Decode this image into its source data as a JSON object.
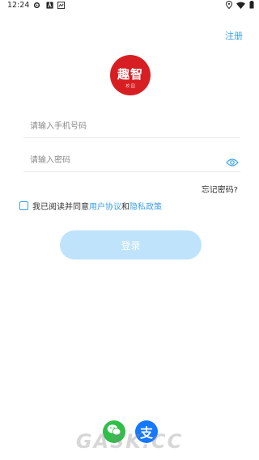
{
  "status_bar": {
    "time": "12:24"
  },
  "header": {
    "register_label": "注册"
  },
  "logo": {
    "text": "趣智",
    "sub": "校 园"
  },
  "form": {
    "phone_placeholder": "请输入手机号码",
    "password_placeholder": "请输入密码",
    "forgot_label": "忘记密码?",
    "agree_prefix": "我已阅读并同意",
    "user_agreement": "用户协议",
    "and": "和",
    "privacy_policy": "隐私政策",
    "login_label": "登录"
  },
  "social": {
    "alipay_glyph": "支"
  },
  "watermark": "GASK.CC",
  "colors": {
    "accent": "#3ba0e8",
    "button_disabled": "#bfe3fb",
    "logo_red": "#d71f23"
  }
}
